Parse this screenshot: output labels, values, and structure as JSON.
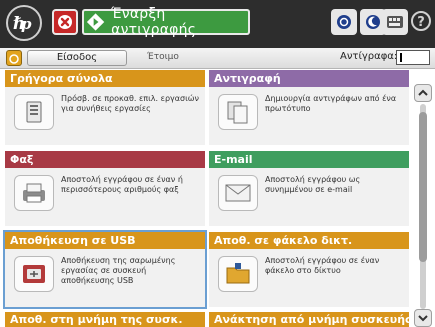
{
  "topbar": {
    "start_label": "Έναρξη αντιγραφής",
    "icons": [
      "hp-logo-icon",
      "stop-icon",
      "start-icon",
      "network-icon",
      "sleep-icon",
      "keyboard-icon",
      "help-icon"
    ]
  },
  "statusbar": {
    "signin_label": "Είσοδος",
    "status_text": "Έτοιμο",
    "copies_label": "Αντίγραφα:",
    "copies_value": ""
  },
  "tiles": [
    {
      "title": "Γρήγορα σύνολα",
      "desc": "Πρόσβ. σε προκαθ. επιλ. εργασιών για συνήθεις εργασίες",
      "color": "#d8951b",
      "icon": "quick-sets-icon"
    },
    {
      "title": "Αντιγραφή",
      "desc": "Δημιουργία αντιγράφων από ένα πρωτότυπο",
      "color": "#8e6ba7",
      "icon": "copy-icon"
    },
    {
      "title": "Φαξ",
      "desc": "Αποστολή εγγράφου σε έναν ή περισσότερους αριθμούς φαξ",
      "color": "#a83a45",
      "icon": "fax-icon"
    },
    {
      "title": "E-mail",
      "desc": "Αποστολή εγγράφου ως συνημμένου σε e-mail",
      "color": "#3f9e5f",
      "icon": "email-icon"
    },
    {
      "title": "Αποθήκευση σε USB",
      "desc": "Αποθήκευση της σαρωμένης εργασίας σε συσκευή αποθήκευσης USB",
      "color": "#d8951b",
      "icon": "usb-icon"
    },
    {
      "title": "Αποθ. σε φάκελο δικτ.",
      "desc": "Αποστολή εγγράφου σε έναν φάκελο στο δίκτυο",
      "color": "#d8951b",
      "icon": "network-folder-icon"
    },
    {
      "title": "Αποθ. στη μνήμη της συσκ.",
      "desc": "",
      "color": "#d8951b",
      "icon": ""
    },
    {
      "title": "Ανάκτηση από μνήμη συσκευής",
      "desc": "",
      "color": "#d8951b",
      "icon": ""
    }
  ],
  "colors": {
    "topbar": "#2d2d2d",
    "start_green": "#3d9a40",
    "stop_red": "#c62828",
    "selection": "#6b9fd2"
  }
}
